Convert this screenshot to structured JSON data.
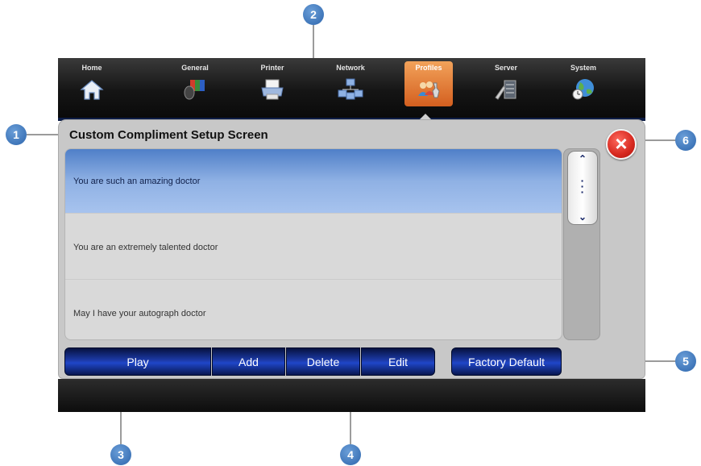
{
  "nav": {
    "items": [
      {
        "label": "Home",
        "icon": "home-icon"
      },
      {
        "label": "General",
        "icon": "general-icon"
      },
      {
        "label": "Printer",
        "icon": "printer-icon"
      },
      {
        "label": "Network",
        "icon": "network-icon"
      },
      {
        "label": "Profiles",
        "icon": "profiles-icon"
      },
      {
        "label": "Server",
        "icon": "server-icon"
      },
      {
        "label": "System",
        "icon": "system-globe-icon"
      }
    ],
    "active": "Profiles"
  },
  "panel": {
    "title": "Custom Compliment Setup Screen",
    "close_icon": "close-icon"
  },
  "list": {
    "items": [
      {
        "text": "You are such an amazing doctor",
        "selected": true
      },
      {
        "text": "You are an extremely talented doctor",
        "selected": false
      },
      {
        "text": "May I have your autograph doctor",
        "selected": false
      }
    ]
  },
  "scroll": {
    "up": "⌃",
    "dots": "⋮",
    "down": "⌄"
  },
  "buttons": {
    "play": "Play",
    "add": "Add",
    "delete": "Delete",
    "edit": "Edit",
    "factory_default": "Factory Default"
  },
  "callouts": [
    "1",
    "2",
    "3",
    "4",
    "5",
    "6"
  ],
  "colors": {
    "accent_active_tab": "#e07a34",
    "selected_row": "#7fa5df",
    "button_blue": "#1f46c8",
    "close_red": "#d6281f",
    "callout_blue": "#3b74ba"
  }
}
